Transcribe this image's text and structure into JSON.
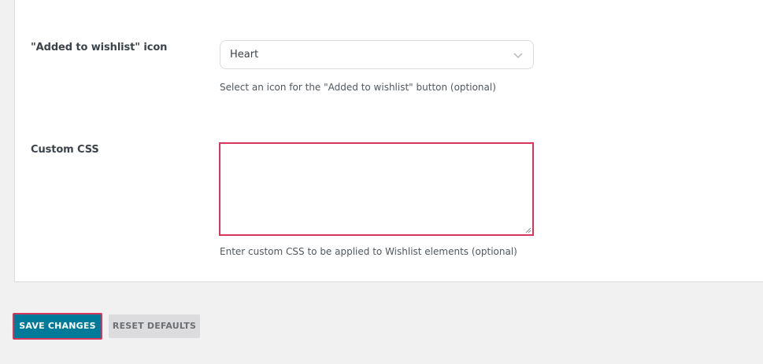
{
  "settings": {
    "added_icon": {
      "label": "\"Added to wishlist\" icon",
      "selected_value": "Heart",
      "help": "Select an icon for the \"Added to wishlist\" button (optional)"
    },
    "custom_css": {
      "label": "Custom CSS",
      "value": "",
      "help": "Enter custom CSS to be applied to Wishlist elements (optional)"
    }
  },
  "actions": {
    "save_label": "SAVE CHANGES",
    "reset_label": "RESET DEFAULTS"
  },
  "colors": {
    "primary_button": "#007a99",
    "focus_border": "#d6365c",
    "secondary_button": "#dcdcde",
    "page_background": "#f1f1f1"
  }
}
